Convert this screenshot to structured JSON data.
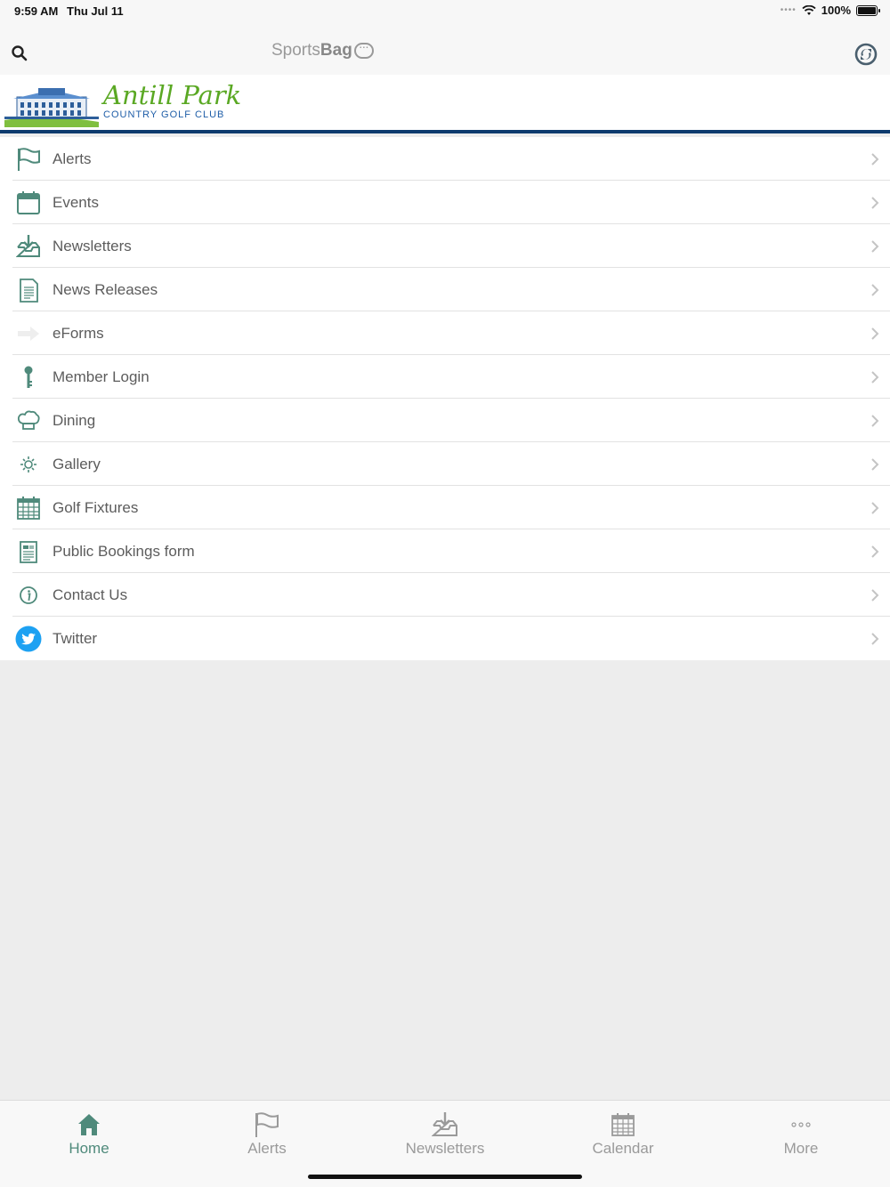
{
  "status_bar": {
    "time": "9:59 AM",
    "date": "Thu Jul 11",
    "battery": "100%"
  },
  "top_bar": {
    "brand_light": "Sports",
    "brand_bold": "Bag"
  },
  "banner": {
    "title": "Antill Park",
    "subtitle": "COUNTRY GOLF CLUB"
  },
  "menu": {
    "items": [
      {
        "label": "Alerts",
        "icon": "flag-icon"
      },
      {
        "label": "Events",
        "icon": "calendar-icon"
      },
      {
        "label": "Newsletters",
        "icon": "inbox-download-icon"
      },
      {
        "label": "News Releases",
        "icon": "document-icon"
      },
      {
        "label": "eForms",
        "icon": "arrow-right-icon"
      },
      {
        "label": "Member Login",
        "icon": "key-icon"
      },
      {
        "label": "Dining",
        "icon": "chef-hat-icon"
      },
      {
        "label": "Gallery",
        "icon": "sun-icon"
      },
      {
        "label": "Golf Fixtures",
        "icon": "calendar-grid-icon"
      },
      {
        "label": "Public Bookings form",
        "icon": "form-icon"
      },
      {
        "label": "Contact Us",
        "icon": "info-icon"
      },
      {
        "label": "Twitter",
        "icon": "twitter-icon"
      }
    ]
  },
  "tabs": [
    {
      "label": "Home",
      "icon": "home-icon",
      "active": true
    },
    {
      "label": "Alerts",
      "icon": "flag-icon"
    },
    {
      "label": "Newsletters",
      "icon": "inbox-download-icon"
    },
    {
      "label": "Calendar",
      "icon": "calendar-grid-icon"
    },
    {
      "label": "More",
      "icon": "more-icon"
    }
  ],
  "colors": {
    "accent": "#4f8a7b",
    "banner_rule": "#0d3b6e",
    "logo_green": "#5aa823",
    "logo_blue": "#1f5ea8",
    "twitter": "#1da1f2"
  }
}
